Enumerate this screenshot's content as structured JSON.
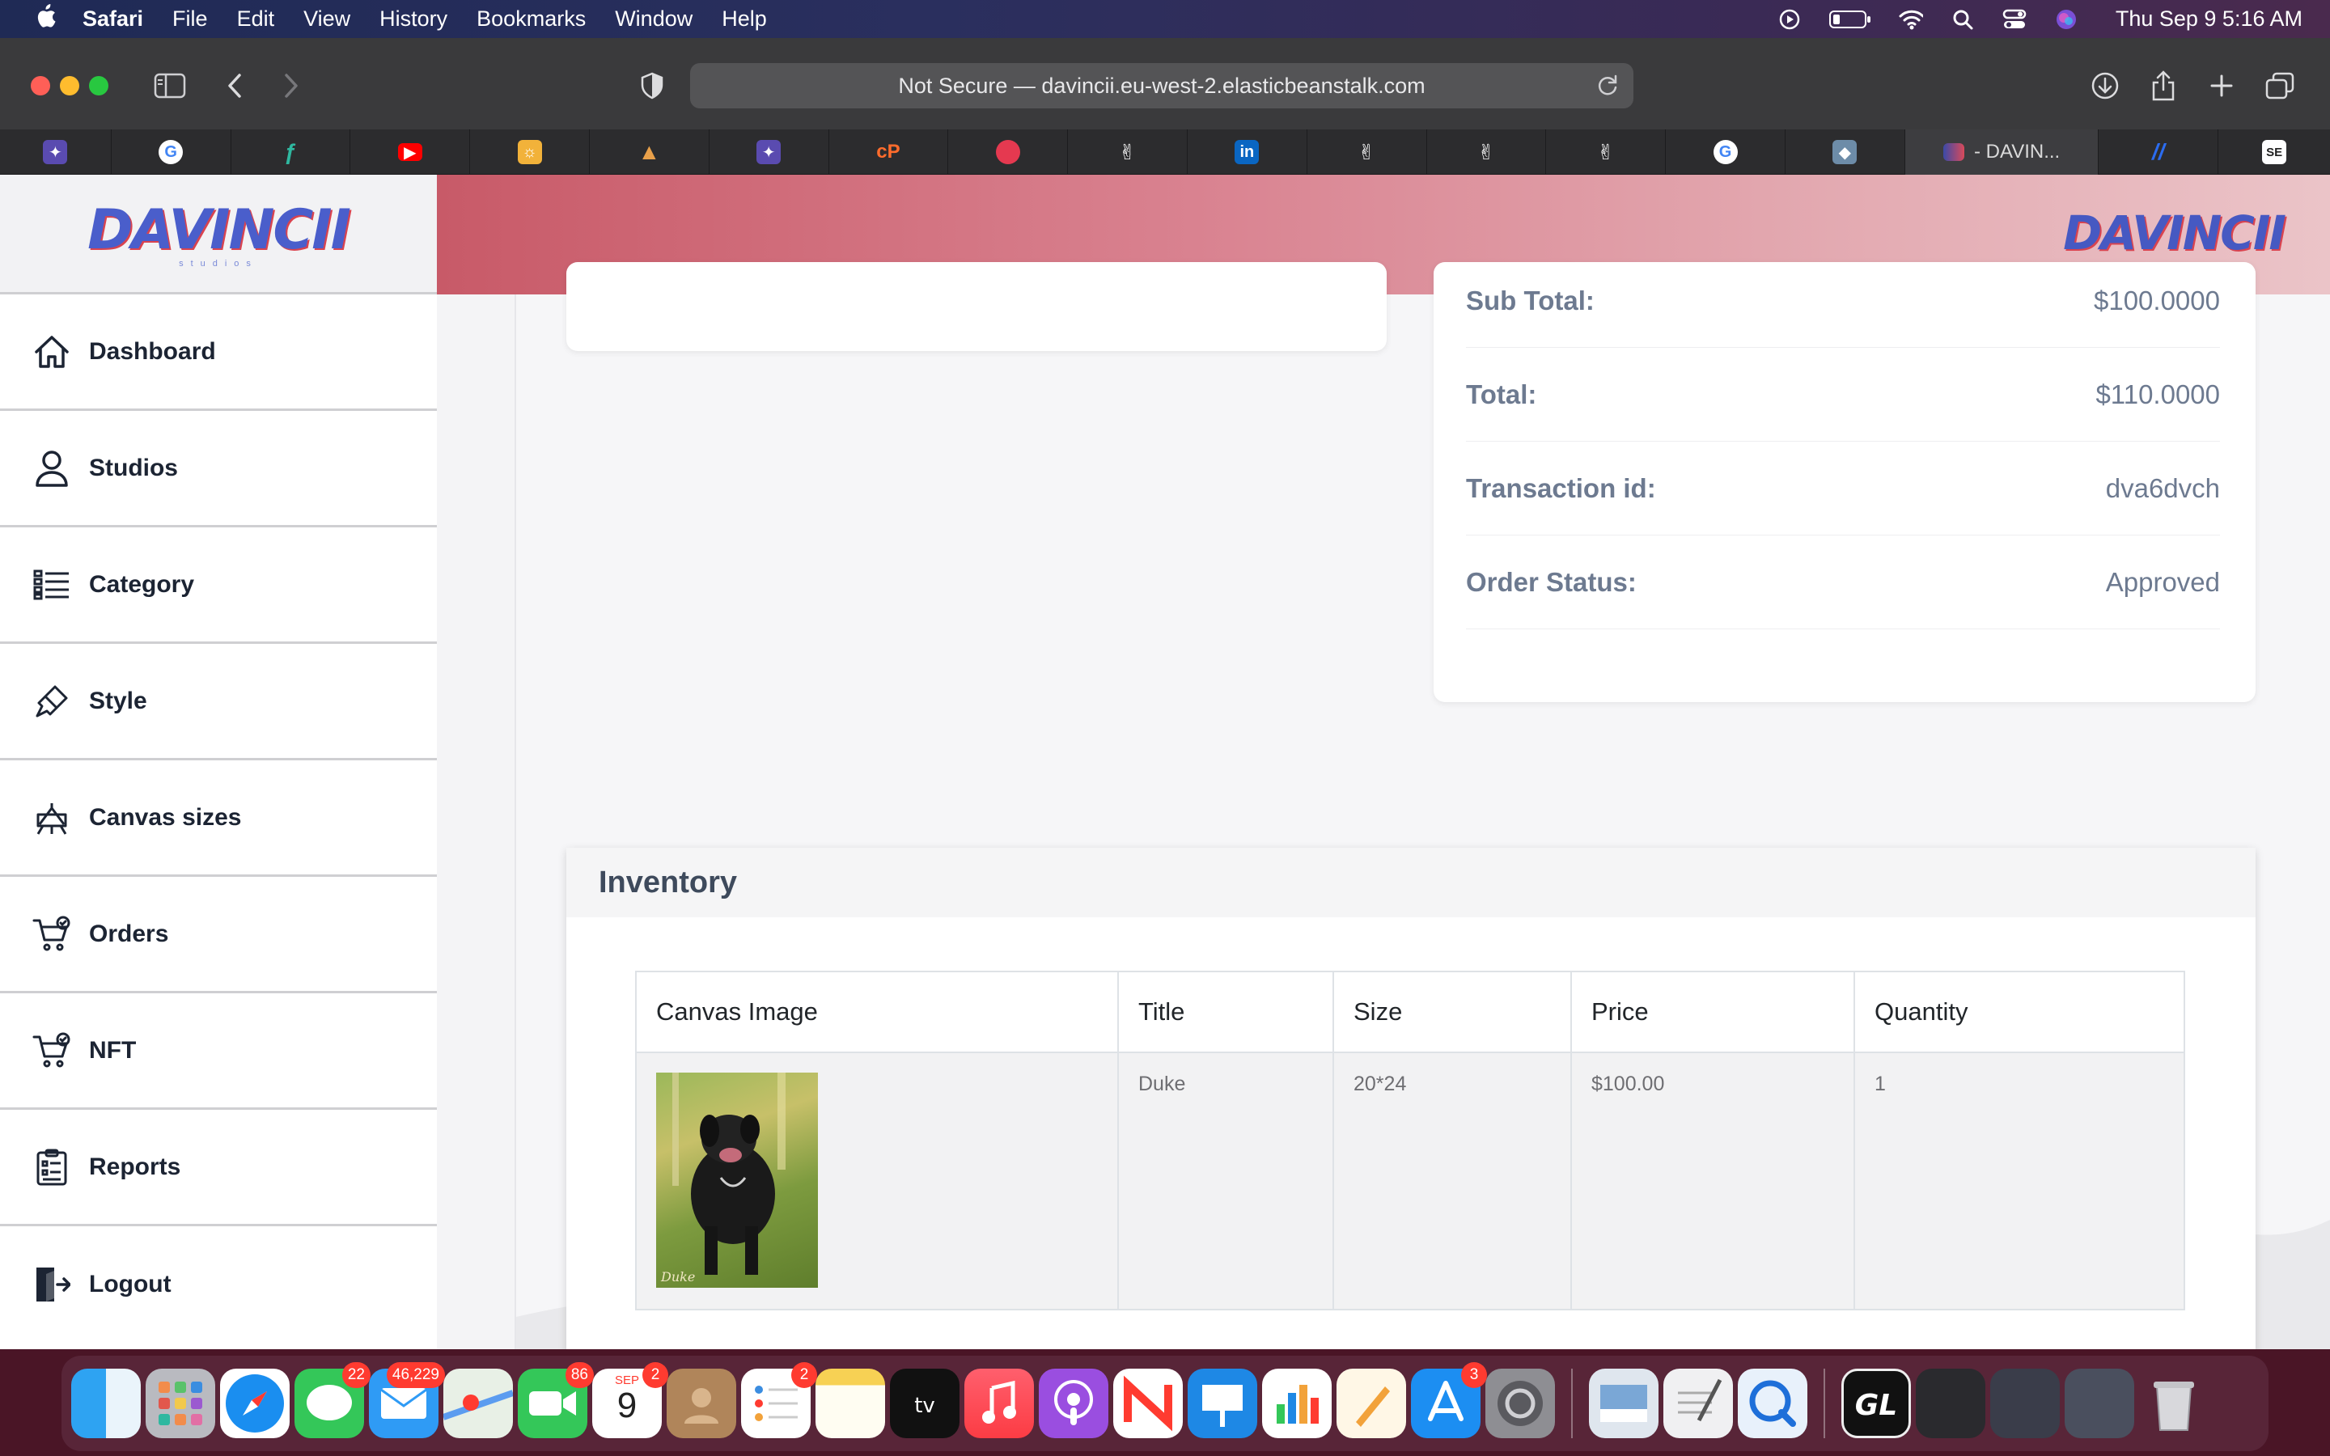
{
  "menubar": {
    "apple_icon": "apple-logo",
    "app_name": "Safari",
    "items": [
      "File",
      "Edit",
      "View",
      "History",
      "Bookmarks",
      "Window",
      "Help"
    ],
    "clock": "Thu Sep 9  5:16 AM"
  },
  "safari": {
    "address": "Not Secure — davincii.eu-west-2.elasticbeanstalk.com",
    "active_tab_label": "- DAVIN..."
  },
  "brand": {
    "logo_text": "DAVINCII",
    "logo_sub": "studios",
    "logo_text_right": "DAVINCII"
  },
  "sidebar": {
    "items": [
      {
        "label": "Dashboard",
        "icon": "home-icon"
      },
      {
        "label": "Studios",
        "icon": "user-icon"
      },
      {
        "label": "Category",
        "icon": "list-icon"
      },
      {
        "label": "Style",
        "icon": "brush-icon"
      },
      {
        "label": "Canvas sizes",
        "icon": "canvas-icon"
      },
      {
        "label": "Orders",
        "icon": "cart-icon"
      },
      {
        "label": "NFT",
        "icon": "cart-icon"
      },
      {
        "label": "Reports",
        "icon": "clipboard-icon"
      },
      {
        "label": "Logout",
        "icon": "logout-icon"
      }
    ]
  },
  "summary": {
    "subtotal_label": "Sub Total:",
    "subtotal_value": "$100.0000",
    "total_label": "Total:",
    "total_value": "$110.0000",
    "transaction_label": "Transaction id:",
    "transaction_value": "dva6dvch",
    "status_label": "Order Status:",
    "status_value": "Approved"
  },
  "inventory": {
    "title": "Inventory",
    "columns": [
      "Canvas Image",
      "Title",
      "Size",
      "Price",
      "Quantity"
    ],
    "rows": [
      {
        "image_caption": "Duke",
        "title": "Duke",
        "size": "20*24",
        "price": "$100.00",
        "quantity": "1"
      }
    ]
  },
  "dock": {
    "badges": {
      "messages": "22",
      "mail": "46,229",
      "facetime": "86",
      "calendar": "2",
      "reminders": "2",
      "appstore": "3"
    },
    "calendar_month": "SEP",
    "calendar_day": "9"
  }
}
